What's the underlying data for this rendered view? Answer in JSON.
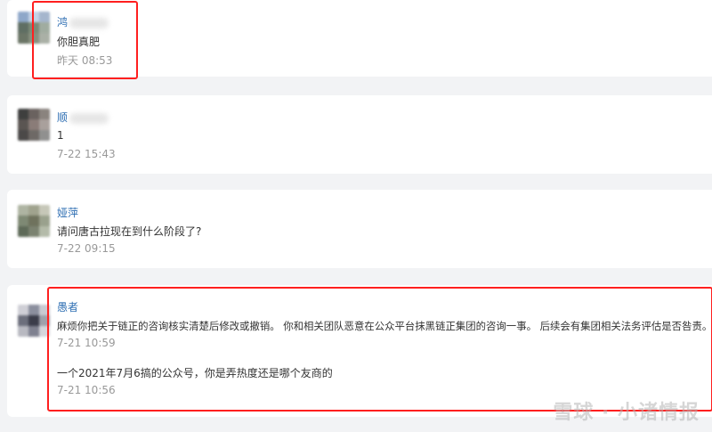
{
  "comments": [
    {
      "author": "鸿",
      "text": "你胆真肥",
      "time": "昨天 08:53",
      "avatar_colors": [
        "#8ea7c9",
        "#c4d3e6",
        "#a5b6cd",
        "#5f6e63",
        "#7c8a77",
        "#a0aca0",
        "#6b7566",
        "#87907f",
        "#aab0a6"
      ]
    },
    {
      "author": "顺",
      "text": "1",
      "time": "7-22 15:43",
      "avatar_colors": [
        "#3e3f3e",
        "#6a625f",
        "#8a837e",
        "#5a5552",
        "#8a7c78",
        "#a9a09c",
        "#4b4948",
        "#6e6966",
        "#90908f"
      ]
    },
    {
      "author": "娅萍",
      "text": "请问唐古拉现在到什么阶段了?",
      "time": "7-22 09:15",
      "avatar_colors": [
        "#aeb4a2",
        "#a0a38e",
        "#c6c7b8",
        "#7e8974",
        "#6f725d",
        "#9aa18d",
        "#5e6a58",
        "#7b8270",
        "#b4bba9"
      ]
    },
    {
      "author": "愚者",
      "replies": [
        {
          "text": "麻烦你把关于链正的咨询核实清楚后修改或撤销。 你和相关团队恶意在公众平台抹黑链正集团的咨询一事。 后续会有集团相关法务评估是否咎责。",
          "time": "7-21 10:59"
        },
        {
          "text": "一个2021年7月6搞的公众号，你是弄热度还是哪个友商的",
          "time": "7-21 10:56"
        }
      ],
      "avatar_colors": [
        "#cfcfd6",
        "#8b8f9e",
        "#c9cad2",
        "#6c6f7c",
        "#3b3d4a",
        "#9fa1ab",
        "#b8b9c1",
        "#7f8190",
        "#d6d6dc"
      ]
    }
  ],
  "watermark": "雪球 · 小诸情报",
  "colors": {
    "name": "#2f6fb3",
    "time": "#999999",
    "highlight": "#ff1f1f",
    "background": "#f2f3f5"
  }
}
